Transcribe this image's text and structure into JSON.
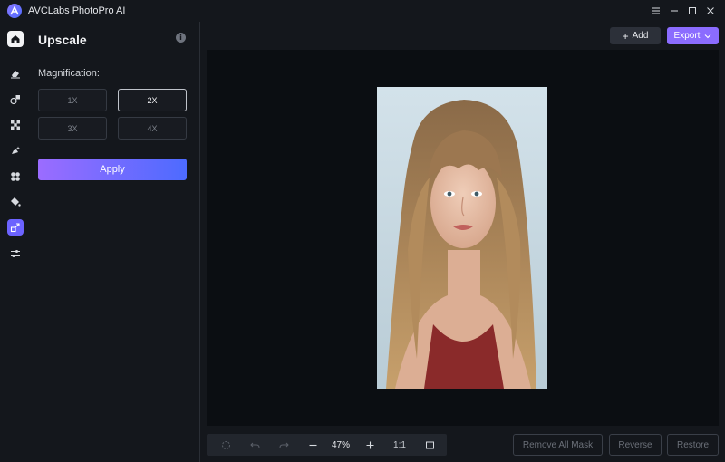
{
  "app": {
    "title": "AVCLabs PhotoPro AI"
  },
  "window_controls": [
    "menu-icon",
    "minimize-icon",
    "maximize-icon",
    "close-icon"
  ],
  "sidebar": {
    "items": [
      {
        "name": "home",
        "icon": "home-icon",
        "active": false
      },
      {
        "name": "object-remover",
        "icon": "eraser-icon",
        "active": false
      },
      {
        "name": "replace",
        "icon": "shapes-icon",
        "active": false
      },
      {
        "name": "remove-background",
        "icon": "pattern-icon",
        "active": false
      },
      {
        "name": "enhance",
        "icon": "spark-person-icon",
        "active": false
      },
      {
        "name": "blur",
        "icon": "fan-icon",
        "active": false
      },
      {
        "name": "colorize",
        "icon": "paint-bucket-icon",
        "active": false
      },
      {
        "name": "upscale",
        "icon": "upscale-icon",
        "active": true
      },
      {
        "name": "adjust",
        "icon": "sliders-icon",
        "active": false
      }
    ]
  },
  "panel": {
    "title": "Upscale",
    "magnification_label": "Magnification:",
    "options": [
      "1X",
      "2X",
      "3X",
      "4X"
    ],
    "selected_option": "2X",
    "apply_label": "Apply"
  },
  "actions": {
    "add_label": "Add",
    "export_label": "Export"
  },
  "toolbar": {
    "zoom": "47%",
    "ratio_label": "1:1"
  },
  "bottom_buttons": {
    "remove_all_mask": "Remove All Mask",
    "reverse": "Reverse",
    "restore": "Restore"
  },
  "colors": {
    "accent": "#8b6cff",
    "apply_gradient_start": "#9b6cff",
    "apply_gradient_end": "#4d6bff",
    "canvas_bg": "#0b0e12"
  }
}
